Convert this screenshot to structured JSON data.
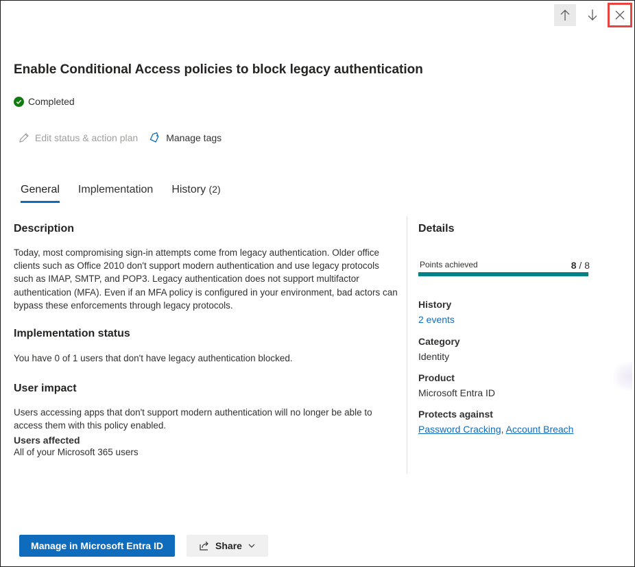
{
  "nav": {
    "up_icon": "arrow-up-icon",
    "down_icon": "arrow-down-icon",
    "close_icon": "close-icon"
  },
  "title": "Enable Conditional Access policies to block legacy authentication",
  "status": {
    "label": "Completed",
    "color": "#107c10"
  },
  "actions": {
    "edit_label": "Edit status & action plan",
    "tags_label": "Manage tags"
  },
  "tabs": [
    {
      "label": "General",
      "active": true
    },
    {
      "label": "Implementation",
      "active": false
    },
    {
      "label": "History",
      "count": "(2)",
      "active": false
    }
  ],
  "description": {
    "heading": "Description",
    "text": "Today, most compromising sign-in attempts come from legacy authentication. Older office clients such as Office 2010 don't support modern authentication and use legacy protocols such as IMAP, SMTP, and POP3. Legacy authentication does not support multifactor authentication (MFA). Even if an MFA policy is configured in your environment, bad actors can bypass these enforcements through legacy protocols."
  },
  "implementation_status": {
    "heading": "Implementation status",
    "text": "You have 0 of 1 users that don't have legacy authentication blocked."
  },
  "user_impact": {
    "heading": "User impact",
    "text": "Users accessing apps that don't support modern authentication will no longer be able to access them with this policy enabled.",
    "affected_label": "Users affected",
    "affected_value": "All of your Microsoft 365 users"
  },
  "details": {
    "heading": "Details",
    "points_label": "Points achieved",
    "points_achieved": "8",
    "points_separator": " / ",
    "points_total": "8",
    "points_fraction": 1.0,
    "bar_color": "#038387",
    "history_label": "History",
    "history_value": "2 events",
    "category_label": "Category",
    "category_value": "Identity",
    "product_label": "Product",
    "product_value": "Microsoft Entra ID",
    "protects_label": "Protects against",
    "protects_items": [
      "Password Cracking",
      "Account Breach"
    ],
    "protects_separator": ","
  },
  "footer": {
    "primary_label": "Manage in Microsoft Entra ID",
    "share_label": "Share",
    "share_icon": "share-icon",
    "chevron_icon": "chevron-down-icon",
    "accent": "#0f6cbd"
  }
}
